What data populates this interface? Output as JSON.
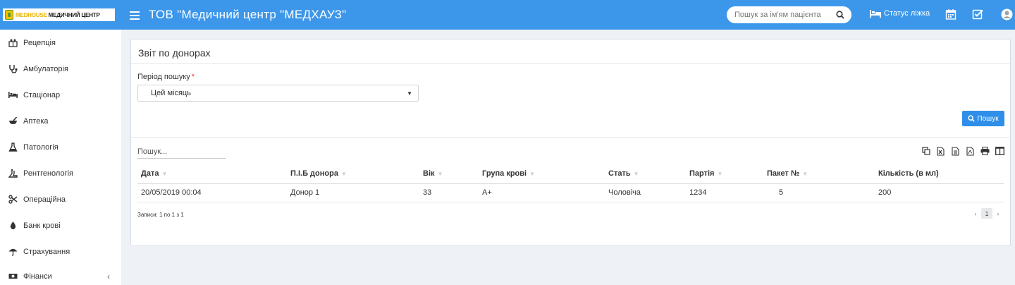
{
  "header": {
    "logo_brand": "MEDHOUSE",
    "logo_sub": "МЕДИЧНИЙ ЦЕНТР",
    "title": "ТОВ \"Медичний центр \"МЕДХАУЗ\"",
    "search_placeholder": "Пошук за ім'ям пацієнта",
    "bed_status": "Статус ліжка",
    "icons": [
      "calendar-icon",
      "checklist-icon",
      "user-avatar-icon"
    ],
    "color": "#3c97ea"
  },
  "sidebar": {
    "items": [
      {
        "label": "Рецепція",
        "icon": "reception-icon"
      },
      {
        "label": "Амбулаторія",
        "icon": "stethoscope-icon"
      },
      {
        "label": "Стаціонар",
        "icon": "bed-icon"
      },
      {
        "label": "Аптека",
        "icon": "mortar-icon"
      },
      {
        "label": "Патологія",
        "icon": "flask-icon"
      },
      {
        "label": "Рентгенологія",
        "icon": "xray-icon"
      },
      {
        "label": "Операційна",
        "icon": "scissors-icon"
      },
      {
        "label": "Банк крові",
        "icon": "blood-drop-icon"
      },
      {
        "label": "Страхування",
        "icon": "umbrella-icon"
      },
      {
        "label": "Фінанси",
        "icon": "money-icon"
      }
    ],
    "collapse_chevron": "‹"
  },
  "panel": {
    "title": "Звіт по донорах",
    "period_label": "Період пошуку",
    "required_mark": "*",
    "period_value": "Цей місяць",
    "search_button": "Пошук",
    "table_search_placeholder": "Пошук...",
    "tools": [
      "copy-icon",
      "excel-icon",
      "csv-icon",
      "pdf-icon",
      "print-icon",
      "columns-icon"
    ]
  },
  "table": {
    "columns": [
      "Дата",
      "П.І.Б донора",
      "Вік",
      "Група крові",
      "Стать",
      "Партія",
      "Пакет №",
      "Кількість (в мл)"
    ],
    "sortable": [
      true,
      true,
      true,
      true,
      true,
      true,
      true,
      false
    ],
    "rows": [
      [
        "20/05/2019 00:04",
        "Донор 1",
        "33",
        "A+",
        "Чоловіча",
        "1234",
        "5",
        "200"
      ]
    ],
    "records_info": "Записи: 1 по 1 з 1",
    "pager": {
      "prev": "‹",
      "page": "1",
      "next": "›"
    }
  },
  "colors": {
    "accent": "#3c97ea",
    "button": "#2f8fe8",
    "background": "#eef1f5"
  }
}
